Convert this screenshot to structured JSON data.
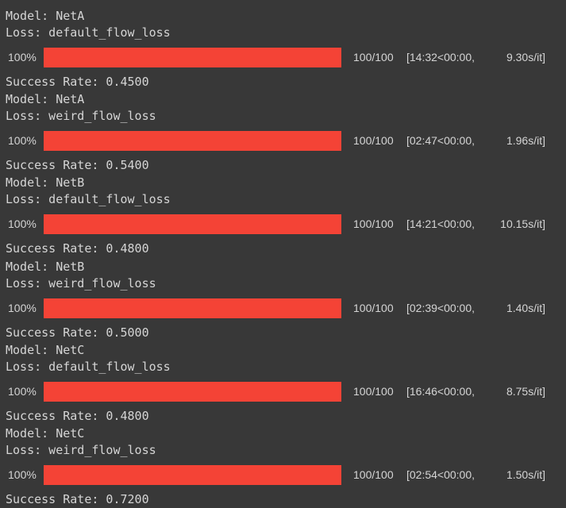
{
  "colors": {
    "background": "#383838",
    "text": "#d5d5d5",
    "bar_fill": "#f44336",
    "bar_track": "#4a4a4a"
  },
  "runs": [
    {
      "model": "Model: NetA",
      "loss": "Loss: default_flow_loss",
      "percent_label": "100%",
      "progress": 1.0,
      "count": "100/100",
      "time": "[14:32<00:00,",
      "rate": "9.30s/it]",
      "success": "Success Rate: 0.4500"
    },
    {
      "model": "Model: NetA",
      "loss": "Loss: weird_flow_loss",
      "percent_label": "100%",
      "progress": 1.0,
      "count": "100/100",
      "time": "[02:47<00:00,",
      "rate": "1.96s/it]",
      "success": "Success Rate: 0.5400"
    },
    {
      "model": "Model: NetB",
      "loss": "Loss: default_flow_loss",
      "percent_label": "100%",
      "progress": 1.0,
      "count": "100/100",
      "time": "[14:21<00:00,",
      "rate": "10.15s/it]",
      "success": "Success Rate: 0.4800"
    },
    {
      "model": "Model: NetB",
      "loss": "Loss: weird_flow_loss",
      "percent_label": "100%",
      "progress": 1.0,
      "count": "100/100",
      "time": "[02:39<00:00,",
      "rate": "1.40s/it]",
      "success": "Success Rate: 0.5000"
    },
    {
      "model": "Model: NetC",
      "loss": "Loss: default_flow_loss",
      "percent_label": "100%",
      "progress": 1.0,
      "count": "100/100",
      "time": "[16:46<00:00,",
      "rate": "8.75s/it]",
      "success": "Success Rate: 0.4800"
    },
    {
      "model": "Model: NetC",
      "loss": "Loss: weird_flow_loss",
      "percent_label": "100%",
      "progress": 1.0,
      "count": "100/100",
      "time": "[02:54<00:00,",
      "rate": "1.50s/it]",
      "success": "Success Rate: 0.7200"
    }
  ]
}
